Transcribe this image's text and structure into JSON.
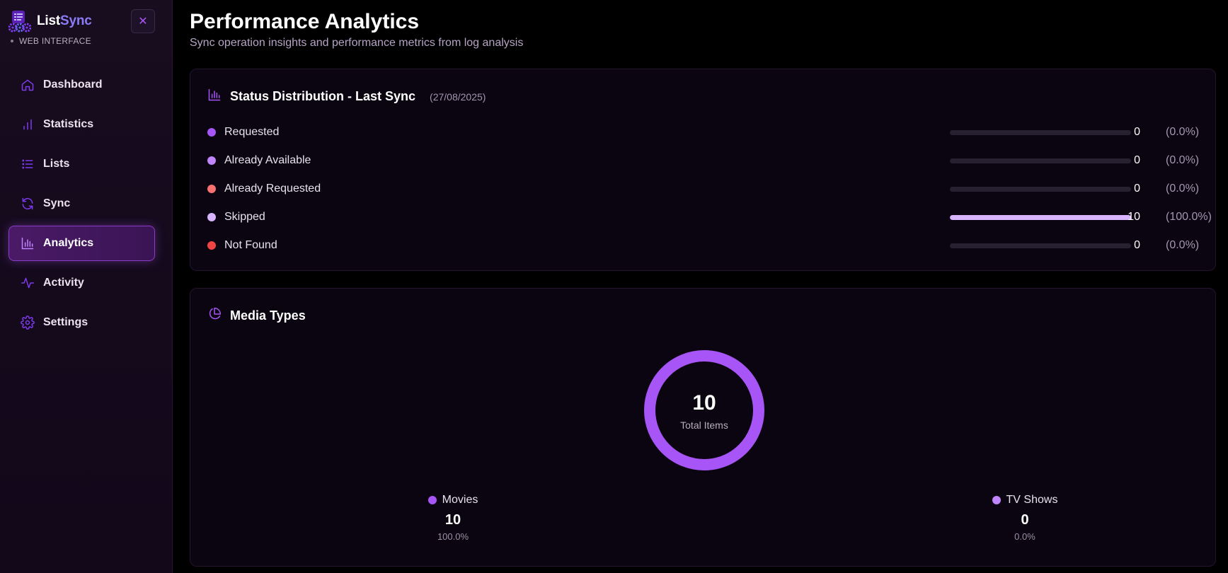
{
  "sidebar": {
    "brand": {
      "part1": "List",
      "part2": "Sync",
      "subtitle": "WEB INTERFACE"
    },
    "close_label": "✕",
    "items": [
      {
        "label": "Dashboard",
        "icon": "home-icon"
      },
      {
        "label": "Statistics",
        "icon": "bar-chart-icon"
      },
      {
        "label": "Lists",
        "icon": "list-icon"
      },
      {
        "label": "Sync",
        "icon": "refresh-icon"
      },
      {
        "label": "Analytics",
        "icon": "analytics-icon",
        "active": true
      },
      {
        "label": "Activity",
        "icon": "activity-icon"
      },
      {
        "label": "Settings",
        "icon": "gear-icon"
      }
    ]
  },
  "header": {
    "title": "Performance Analytics",
    "subtitle": "Sync operation insights and performance metrics from log analysis"
  },
  "status_card": {
    "title": "Status Distribution - Last Sync",
    "date": "(27/08/2025)",
    "rows": [
      {
        "label": "Requested",
        "count": "0",
        "pct": "(0.0%)",
        "fraction": 0,
        "color": "#a855f7"
      },
      {
        "label": "Already Available",
        "count": "0",
        "pct": "(0.0%)",
        "fraction": 0,
        "color": "#c084fc"
      },
      {
        "label": "Already Requested",
        "count": "0",
        "pct": "(0.0%)",
        "fraction": 0,
        "color": "#f87171"
      },
      {
        "label": "Skipped",
        "count": "10",
        "pct": "(100.0%)",
        "fraction": 1,
        "color": "#d8b4fe"
      },
      {
        "label": "Not Found",
        "count": "0",
        "pct": "(0.0%)",
        "fraction": 0,
        "color": "#ef4444"
      }
    ]
  },
  "media_card": {
    "title": "Media Types",
    "total": "10",
    "total_label": "Total Items",
    "items": [
      {
        "name": "Movies",
        "value": "10",
        "pct": "100.0%",
        "fraction": 1,
        "color": "#a855f7"
      },
      {
        "name": "TV Shows",
        "value": "0",
        "pct": "0.0%",
        "fraction": 0,
        "color": "#c084fc"
      }
    ]
  },
  "colors": {
    "accent": "#a855f7",
    "accent_light": "#d8b4fe",
    "card_bg": "#0a0510"
  }
}
